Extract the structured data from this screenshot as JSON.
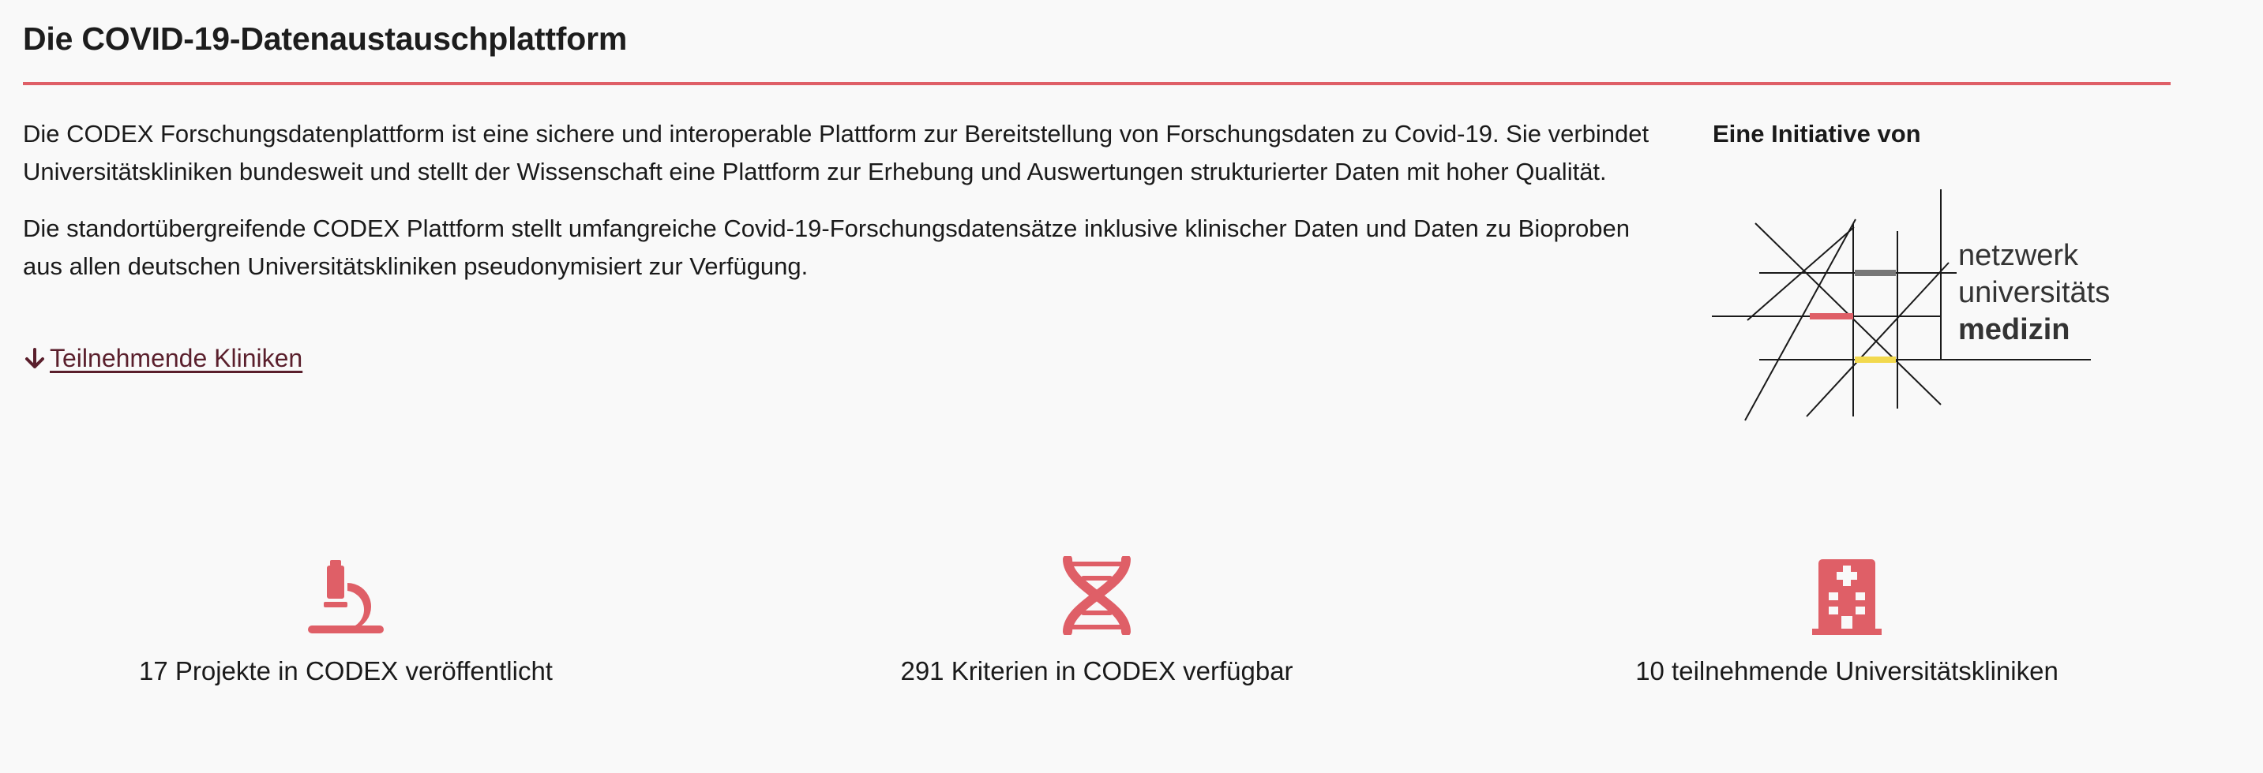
{
  "header": {
    "title": "Die COVID-19-Datenaustauschplattform"
  },
  "intro": {
    "paragraph_1": "Die CODEX Forschungsdatenplattform ist eine sichere und interoperable Plattform zur Bereitstellung von Forschungsdaten zu Covid-19. Sie verbindet Universitätskliniken bundesweit und stellt der Wissenschaft eine Plattform zur Erhebung und Auswertungen strukturierter Daten mit hoher Qualität.",
    "paragraph_2": "Die standortübergreifende CODEX Plattform stellt umfangreiche Covid-19-Forschungsdatensätze inklusive klinischer Daten und Daten zu Bioproben aus allen deutschen Universitätskliniken pseudonymisiert zur Verfügung.",
    "link_label": " Teilnehmende Kliniken",
    "link_icon": "arrow-down-icon"
  },
  "initiative": {
    "label": "Eine Initiative von",
    "logo_lines": [
      "netzwerk",
      "universitäts",
      "medizin"
    ]
  },
  "stats": [
    {
      "icon": "microscope-icon",
      "text": "17 Projekte in CODEX veröffentlicht"
    },
    {
      "icon": "dna-icon",
      "text": "291 Kriterien in CODEX verfügbar"
    },
    {
      "icon": "hospital-icon",
      "text": "10 teilnehmende Universitätskliniken"
    }
  ],
  "colors": {
    "accent": "#df5f67",
    "link": "#5a1f2c",
    "background": "#f9f9f9",
    "logo_gray": "#777777",
    "logo_yellow": "#f2d94e"
  }
}
